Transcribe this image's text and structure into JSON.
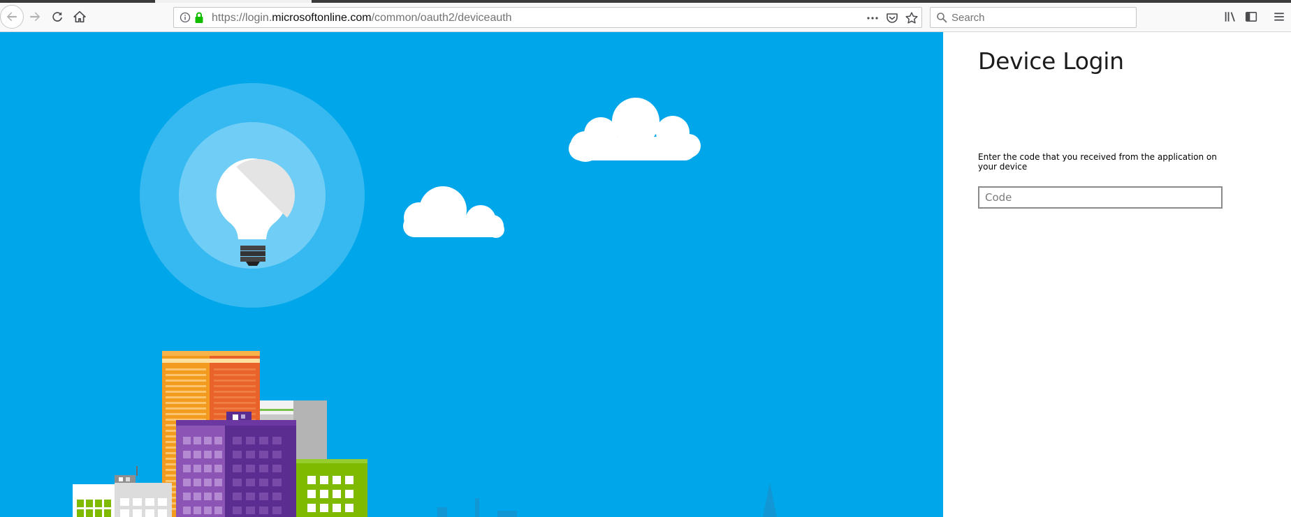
{
  "browser": {
    "url_prefix": "https://login.",
    "url_host": "microsoftonline.com",
    "url_path": "/common/oauth2/deviceauth",
    "search_placeholder": "Search"
  },
  "icons": {
    "back": "back-arrow-icon",
    "forward": "forward-arrow-icon",
    "reload": "reload-icon",
    "home": "home-icon",
    "site_info": "info-icon",
    "secure": "lock-icon",
    "page_actions": "ellipsis-icon",
    "pocket": "pocket-icon",
    "bookmark": "star-icon",
    "search": "magnifier-icon",
    "library": "library-icon",
    "sidebar": "sidebar-icon",
    "menu": "hamburger-menu-icon"
  },
  "colors": {
    "hero_background": "#00a6ea",
    "lock_green": "#12bc00",
    "panel_background": "#ffffff"
  },
  "login": {
    "title": "Device Login",
    "description": "Enter the code that you received from the application on your device",
    "code_placeholder": "Code",
    "code_value": ""
  }
}
